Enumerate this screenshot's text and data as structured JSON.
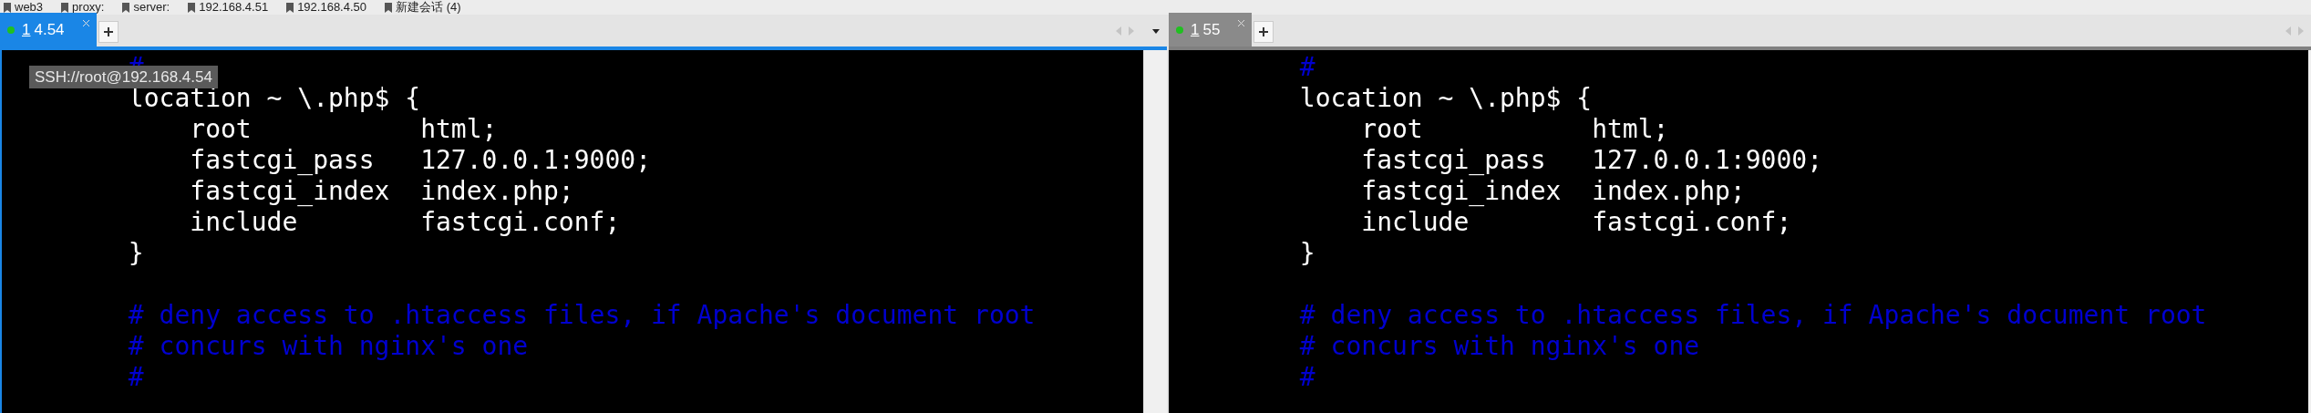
{
  "bookmarks": [
    {
      "label": "web3"
    },
    {
      "label": "proxy:"
    },
    {
      "label": "server:"
    },
    {
      "label": "192.168.4.51"
    },
    {
      "label": "192.168.4.50"
    },
    {
      "label": "新建会话 (4)"
    }
  ],
  "panes": [
    {
      "active": true,
      "tab": {
        "number": "1",
        "label": "4.54",
        "connected": true,
        "selected": true
      },
      "tooltip": "SSH://root@192.168.4.54",
      "lines": [
        {
          "kind": "comment",
          "text": "        #"
        },
        {
          "kind": "code",
          "text": "        location ~ \\.php$ {"
        },
        {
          "kind": "code",
          "text": "            root           html;"
        },
        {
          "kind": "code",
          "text": "            fastcgi_pass   127.0.0.1:9000;"
        },
        {
          "kind": "code",
          "text": "            fastcgi_index  index.php;"
        },
        {
          "kind": "code",
          "text": "            include        fastcgi.conf;"
        },
        {
          "kind": "code",
          "text": "        }"
        },
        {
          "kind": "blank"
        },
        {
          "kind": "comment",
          "text": "        # deny access to .htaccess files, if Apache's document root"
        },
        {
          "kind": "comment",
          "text": "        # concurs with nginx's one"
        },
        {
          "kind": "comment",
          "text": "        #"
        }
      ]
    },
    {
      "active": false,
      "tab": {
        "number": "1",
        "label": "55",
        "connected": true,
        "selected": true
      },
      "lines": [
        {
          "kind": "comment",
          "text": "        #"
        },
        {
          "kind": "code",
          "text": "        location ~ \\.php$ {"
        },
        {
          "kind": "code",
          "text": "            root           html;"
        },
        {
          "kind": "code",
          "text": "            fastcgi_pass   127.0.0.1:9000;"
        },
        {
          "kind": "code",
          "text": "            fastcgi_index  index.php;"
        },
        {
          "kind": "code",
          "text": "            include        fastcgi.conf;"
        },
        {
          "kind": "code",
          "text": "        }"
        },
        {
          "kind": "blank"
        },
        {
          "kind": "comment",
          "text": "        # deny access to .htaccess files, if Apache's document root"
        },
        {
          "kind": "comment",
          "text": "        # concurs with nginx's one"
        },
        {
          "kind": "comment",
          "text": "        #"
        }
      ]
    }
  ]
}
